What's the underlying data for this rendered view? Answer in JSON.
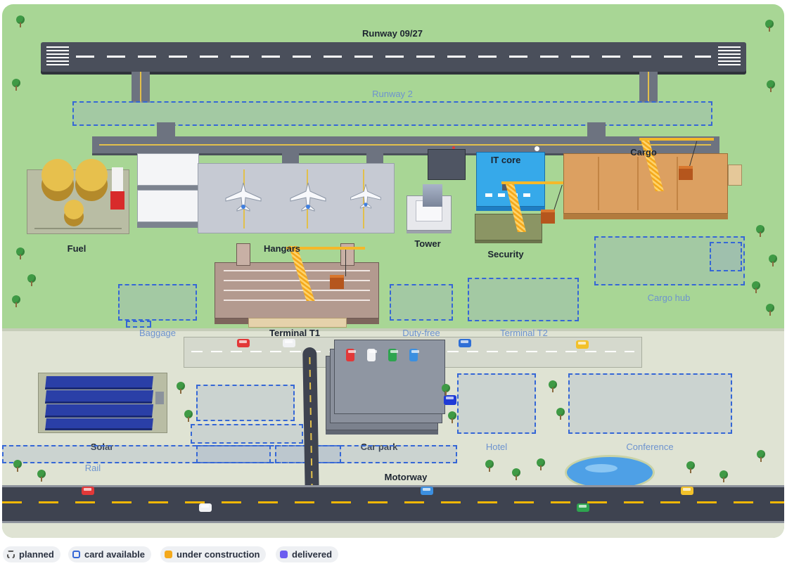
{
  "labels": {
    "runway": "Runway 09/27",
    "fuel": "Fuel",
    "hangars": "Hangars",
    "tower": "Tower",
    "it_core": "IT core",
    "security": "Security",
    "cargo": "Cargo",
    "terminal_t1": "Terminal T1",
    "solar": "Solar",
    "car_park": "Car park",
    "motorway": "Motorway"
  },
  "planned_labels": {
    "runway_2": "Runway 2",
    "cargo_hub": "Cargo hub",
    "baggage": "Baggage",
    "duty_free": "Duty-free",
    "terminal_t2": "Terminal T2",
    "hotel": "Hotel",
    "conference": "Conference",
    "rail": "Rail"
  },
  "legend": {
    "planned": "planned",
    "card_available": "card available",
    "under_construction": "under construction",
    "delivered": "delivered"
  },
  "colors": {
    "grass": "#a8d695",
    "road": "#3e4350",
    "planned_border": "#3567d6",
    "construction": "#f4a91c",
    "delivered": "#6b5cf0",
    "it_core": "#36a9ea",
    "cargo": "#dca061"
  }
}
